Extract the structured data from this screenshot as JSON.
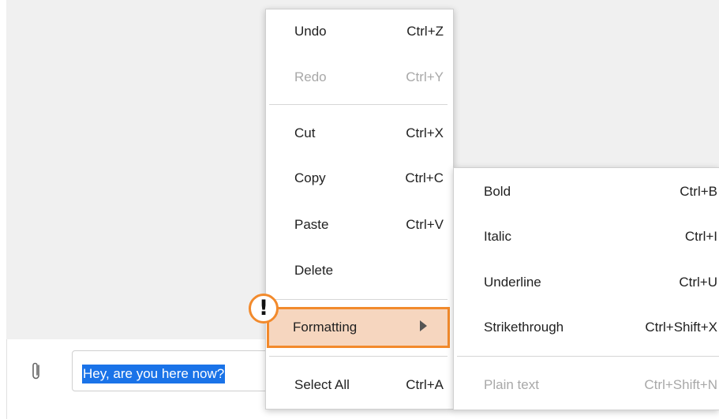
{
  "colors": {
    "highlight_fill": "#f6d6bf",
    "highlight_border": "#f28a2c",
    "selection": "#1a73e8"
  },
  "composer": {
    "message_text": "Hey, are you here now?",
    "attach_icon": "paperclip-icon"
  },
  "context_menu": {
    "items": [
      {
        "label": "Undo",
        "shortcut": "Ctrl+Z",
        "enabled": true
      },
      {
        "label": "Redo",
        "shortcut": "Ctrl+Y",
        "enabled": false
      },
      {
        "label": "Cut",
        "shortcut": "Ctrl+X",
        "enabled": true
      },
      {
        "label": "Copy",
        "shortcut": "Ctrl+C",
        "enabled": true
      },
      {
        "label": "Paste",
        "shortcut": "Ctrl+V",
        "enabled": true
      },
      {
        "label": "Delete",
        "shortcut": "",
        "enabled": true
      },
      {
        "label": "Formatting",
        "shortcut": "",
        "enabled": true,
        "submenu": true,
        "highlighted": true
      },
      {
        "label": "Select All",
        "shortcut": "Ctrl+A",
        "enabled": true
      }
    ]
  },
  "formatting_submenu": {
    "items": [
      {
        "label": "Bold",
        "shortcut": "Ctrl+B",
        "enabled": true
      },
      {
        "label": "Italic",
        "shortcut": "Ctrl+I",
        "enabled": true
      },
      {
        "label": "Underline",
        "shortcut": "Ctrl+U",
        "enabled": true
      },
      {
        "label": "Strikethrough",
        "shortcut": "Ctrl+Shift+X",
        "enabled": true
      },
      {
        "label": "Plain text",
        "shortcut": "Ctrl+Shift+N",
        "enabled": false
      }
    ]
  },
  "callout": {
    "symbol": "!",
    "icon": "exclamation-icon"
  }
}
